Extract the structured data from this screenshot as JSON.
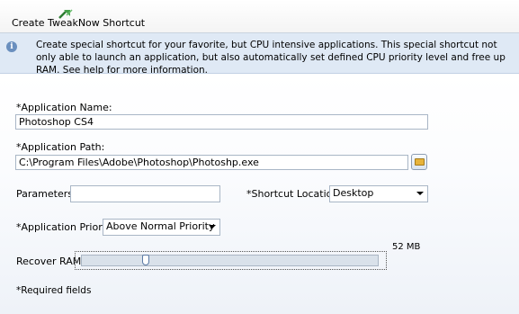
{
  "window": {
    "title": "Create TweakNow Shortcut"
  },
  "info": {
    "text": "Create special shortcut for your favorite, but CPU intensive applications. This special shortcut not only able to launch an application, but also automatically set defined CPU priority level and free up RAM.  See help for more information."
  },
  "form": {
    "app_name_label": "*Application Name:",
    "app_name_value": "Photoshop CS4",
    "app_path_label": "*Application Path:",
    "app_path_value": "C:\\Program Files\\Adobe\\Photoshop\\Photoshp.exe",
    "parameters_label": "Parameters:",
    "parameters_value": "",
    "shortcut_location_label": "*Shortcut Location:",
    "shortcut_location_value": "Desktop",
    "priority_label": "*Application Priority:",
    "priority_value": "Above Normal Priority",
    "recover_ram_label": "Recover RAM",
    "recover_ram_value_label": "52 MB",
    "recover_ram_fraction": 0.21,
    "required_note": "*Required fields"
  },
  "icons": [
    "tweaknow-logo-icon",
    "info-icon",
    "folder-icon",
    "chevron-down-icon"
  ]
}
